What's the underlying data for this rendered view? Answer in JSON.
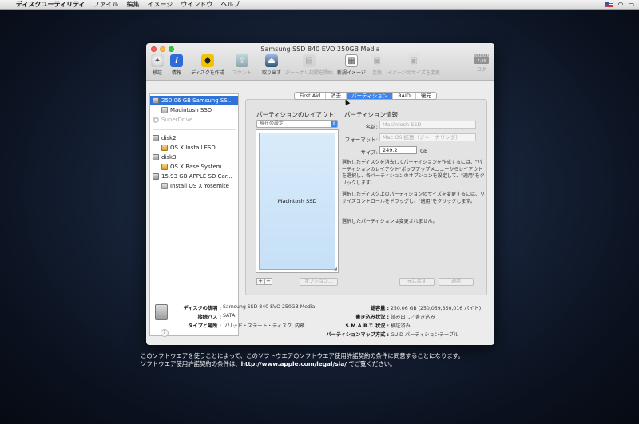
{
  "menubar": {
    "app": "ディスクユーティリティ",
    "items": [
      "ファイル",
      "編集",
      "イメージ",
      "ウインドウ",
      "ヘルプ"
    ],
    "time": ""
  },
  "window": {
    "title": "Samsung SSD 840 EVO 250GB Media",
    "toolbar": [
      {
        "label": "検証",
        "icon": "microscope-icon",
        "enabled": true
      },
      {
        "label": "情報",
        "icon": "info-icon",
        "enabled": true
      },
      {
        "label": "ディスクを作成",
        "icon": "burn-icon",
        "enabled": true
      },
      {
        "label": "マウント",
        "icon": "mount-icon",
        "enabled": false
      },
      {
        "label": "取り出す",
        "icon": "eject-icon",
        "enabled": true
      },
      {
        "label": "ジャーナリ記録を開始",
        "icon": "journal-icon",
        "enabled": false
      },
      {
        "label": "新規イメージ",
        "icon": "new-image-icon",
        "enabled": true
      },
      {
        "label": "変換",
        "icon": "convert-icon",
        "enabled": false
      },
      {
        "label": "イメージのサイズを変更",
        "icon": "resize-image-icon",
        "enabled": false
      },
      {
        "label": "ログ",
        "icon": "log-icon",
        "enabled": false
      }
    ],
    "log_badge": "WARNIN 7:36"
  },
  "sidebar": {
    "items": [
      {
        "label": "250.06 GB Samsung SS...",
        "type": "disk",
        "selected": true
      },
      {
        "label": "Macintosh SSD",
        "type": "volume",
        "selected": false
      },
      {
        "label": "SuperDrive",
        "type": "optical",
        "selected": false
      },
      {
        "label": "disk2",
        "type": "disk",
        "selected": false
      },
      {
        "label": "OS X Install ESD",
        "type": "volume",
        "selected": false
      },
      {
        "label": "disk3",
        "type": "disk",
        "selected": false
      },
      {
        "label": "OS X Base System",
        "type": "usb",
        "selected": false
      },
      {
        "label": "15.93 GB APPLE SD Car...",
        "type": "disk",
        "selected": false
      },
      {
        "label": "Install OS X Yosemite",
        "type": "volume",
        "selected": false
      }
    ]
  },
  "tabs": [
    {
      "label": "First Aid",
      "active": false
    },
    {
      "label": "消去",
      "active": false
    },
    {
      "label": "パーティション",
      "active": true
    },
    {
      "label": "RAID",
      "active": false
    },
    {
      "label": "復元",
      "active": false
    }
  ],
  "partition": {
    "layout_title": "パーティションのレイアウト:",
    "layout_select": "現在の設定",
    "partition_name": "Macintosh SSD",
    "info_title": "パーティション情報",
    "name_label": "名前:",
    "name_value": "Macintosh SSD",
    "format_label": "フォーマット:",
    "format_value": "Mac OS 拡張（ジャーナリング）",
    "size_label": "サイズ:",
    "size_value": "249.2",
    "size_unit": "GB",
    "help1": "選択したディスクを消去してパーティションを作成するには、\"パーティションのレイアウト\"ポップアップメニューからレイアウトを選択し、各パーティションのオプションを設定して、\"適用\"をクリックします。",
    "help2": "選択したディスク上のパーティションのサイズを変更するには、リサイズコントロールをドラッグし、\"適用\"をクリックします。",
    "help3": "選択したパーティションは変更されません。",
    "plus": "+",
    "minus": "−",
    "options_button": "オプション...",
    "revert_button": "元に戻す",
    "apply_button": "適用"
  },
  "info": {
    "description_label": "ディスクの説明 :",
    "description_value": "Samsung SSD 840 EVO 250GB Media",
    "bus_label": "接続バス :",
    "bus_value": "SATA",
    "type_label": "タイプと場所 :",
    "type_value": "ソリッド・ステート・ディスク, 内蔵",
    "capacity_label": "総容量 :",
    "capacity_value": "250.06 GB (250,059,350,016 バイト)",
    "write_label": "書き込み状況 :",
    "write_value": "読み出し／書き込み",
    "smart_label": "S.M.A.R.T. 状況 :",
    "smart_value": "検証済み",
    "map_label": "パーティションマップ方式 :",
    "map_value": "GUID パーティションテーブル",
    "help_glyph": "?"
  },
  "license": {
    "line1": "このソフトウエアを使うことによって、このソフトウエアのソフトウエア使用許諾契約の条件に同意することになります。",
    "line2_prefix": "ソフトウエア使用許諾契約の条件は、",
    "line2_url": "http://www.apple.com/legal/sla/",
    "line2_suffix": " でご覧ください。"
  }
}
